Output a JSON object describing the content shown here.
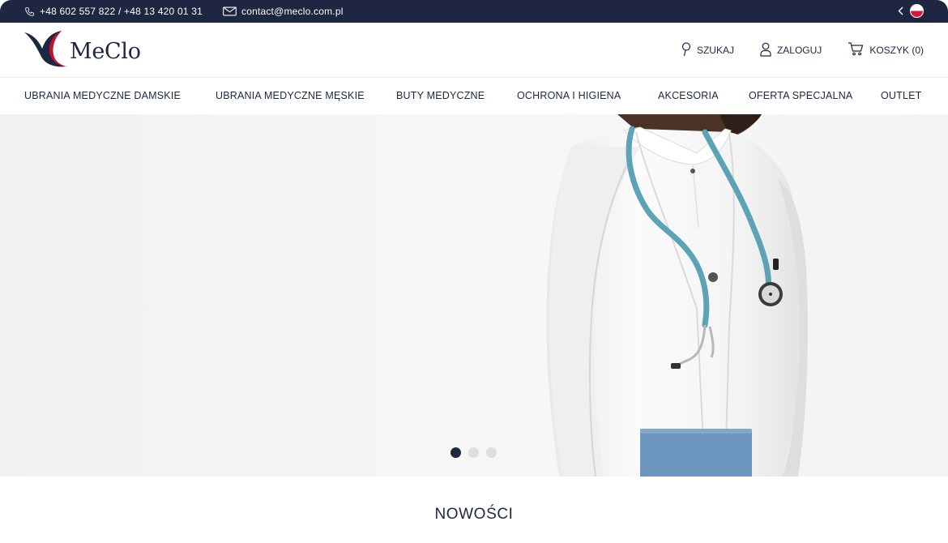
{
  "topbar": {
    "phone": "+48 602 557 822 / +48 13 420 01 31",
    "email": "contact@meclo.com.pl",
    "language": {
      "flag": "poland-flag",
      "colors": [
        "#ffffff",
        "#dc143c"
      ]
    }
  },
  "header": {
    "logo_text": "MeClo",
    "actions": {
      "search": "SZUKAJ",
      "login": "ZALOGUJ",
      "cart": "KOSZYK (0)"
    }
  },
  "nav": {
    "items": [
      "UBRANIA MEDYCZNE DAMSKIE",
      "UBRANIA MEDYCZNE MĘSKIE",
      "BUTY MEDYCZNE",
      "OCHRONA I HIGIENA",
      "AKCESORIA",
      "OFERTA SPECJALNA",
      "OUTLET"
    ]
  },
  "hero": {
    "slide_count": 3,
    "active_slide": 1
  },
  "section": {
    "title": "NOWOŚCI"
  },
  "colors": {
    "navy": "#1e2642",
    "accent_red": "#c8102e",
    "stethoscope": "#5ba3b5",
    "folder": "#6e97bf"
  }
}
